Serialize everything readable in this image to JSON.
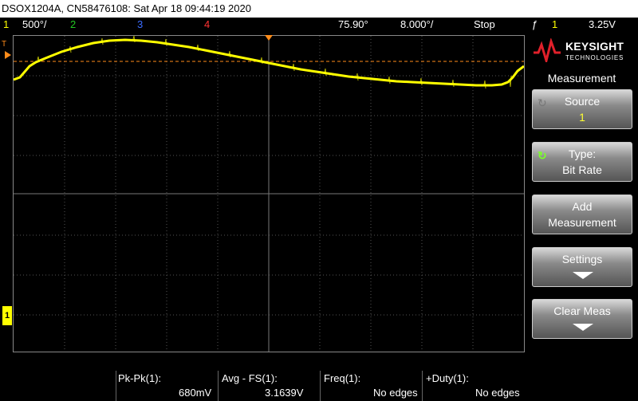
{
  "title": "DSOX1204A, CN58476108: Sat Apr 18 09:44:19 2020",
  "status": {
    "ch1_num": "1",
    "ch1_scale": "500°/",
    "ch2_num": "2",
    "ch3_num": "3",
    "ch4_num": "4",
    "delay": "75.90°",
    "timebase": "8.000°/",
    "run_state": "Stop",
    "trigger_icon": "ƒ",
    "trigger_source": "1",
    "trigger_level": "3.25V"
  },
  "colors": {
    "ch1": "#ffff00",
    "ch2": "#22c822",
    "ch3": "#3b6cff",
    "ch4": "#ff3333",
    "trigger_marker": "#ff8c1a"
  },
  "logo": {
    "brand": "KEYSIGHT",
    "sub": "TECHNOLOGIES"
  },
  "menu": {
    "title": "Measurement",
    "source_label": "Source",
    "source_value": "1",
    "type_label": "Type:",
    "type_value": "Bit Rate",
    "add_l1": "Add",
    "add_l2": "Measurement",
    "settings_label": "Settings",
    "clear_label": "Clear Meas"
  },
  "measurements": {
    "pkpk_label": "Pk-Pk(1):",
    "pkpk_value": "680mV",
    "avg_label": "Avg - FS(1):",
    "avg_value": "3.1639V",
    "freq_label": "Freq(1):",
    "freq_value": "No edges",
    "duty_label": "+Duty(1):",
    "duty_value": "No edges"
  },
  "markers": {
    "trigger_pos": "T",
    "ground_ref": "1"
  }
}
